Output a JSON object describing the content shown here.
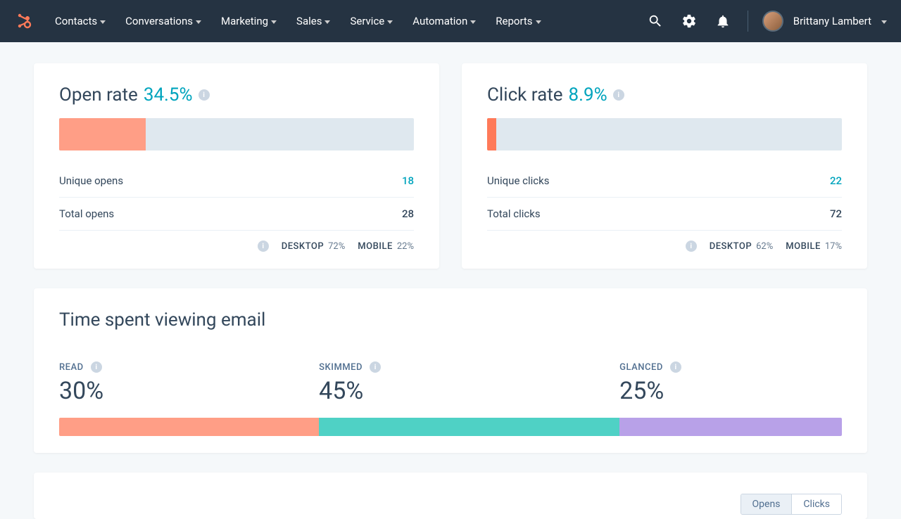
{
  "nav": {
    "items": [
      "Contacts",
      "Conversations",
      "Marketing",
      "Sales",
      "Service",
      "Automation",
      "Reports"
    ],
    "user_name": "Brittany Lambert"
  },
  "open_rate": {
    "title": "Open rate",
    "pct": "34.5%",
    "bar_width_css": "24.4%",
    "stats": [
      {
        "label": "Unique opens",
        "value": "18",
        "link": true
      },
      {
        "label": "Total opens",
        "value": "28",
        "link": false
      }
    ],
    "devices": {
      "desktop_label": "DESKTOP",
      "desktop_pct": "72%",
      "mobile_label": "MOBILE",
      "mobile_pct": "22%"
    }
  },
  "click_rate": {
    "title": "Click rate",
    "pct": "8.9%",
    "bar_width_css": "2.5%",
    "stats": [
      {
        "label": "Unique clicks",
        "value": "22",
        "link": true
      },
      {
        "label": "Total clicks",
        "value": "72",
        "link": false
      }
    ],
    "devices": {
      "desktop_label": "DESKTOP",
      "desktop_pct": "62%",
      "mobile_label": "MOBILE",
      "mobile_pct": "17%"
    }
  },
  "time_spent": {
    "title": "Time spent viewing email",
    "segments": [
      {
        "label": "READ",
        "pct": "30%",
        "width": "33.2%",
        "class": "seg-read"
      },
      {
        "label": "SKIMMED",
        "pct": "45%",
        "width": "38.4%",
        "class": "seg-skimmed"
      },
      {
        "label": "GLANCED",
        "pct": "25%",
        "width": "28.4%",
        "class": "seg-glanced"
      }
    ]
  },
  "bottom_tabs": {
    "opens": "Opens",
    "clicks": "Clicks"
  },
  "chart_data": [
    {
      "type": "bar",
      "title": "Open rate",
      "categories": [
        "Open rate"
      ],
      "values": [
        34.5
      ],
      "ylim": [
        0,
        100
      ],
      "breakdown": {
        "Unique opens": 18,
        "Total opens": 28,
        "Desktop %": 72,
        "Mobile %": 22
      }
    },
    {
      "type": "bar",
      "title": "Click rate",
      "categories": [
        "Click rate"
      ],
      "values": [
        8.9
      ],
      "ylim": [
        0,
        100
      ],
      "breakdown": {
        "Unique clicks": 22,
        "Total clicks": 72,
        "Desktop %": 62,
        "Mobile %": 17
      }
    },
    {
      "type": "bar",
      "title": "Time spent viewing email",
      "categories": [
        "Read",
        "Skimmed",
        "Glanced"
      ],
      "values": [
        30,
        45,
        25
      ],
      "ylim": [
        0,
        100
      ]
    }
  ]
}
